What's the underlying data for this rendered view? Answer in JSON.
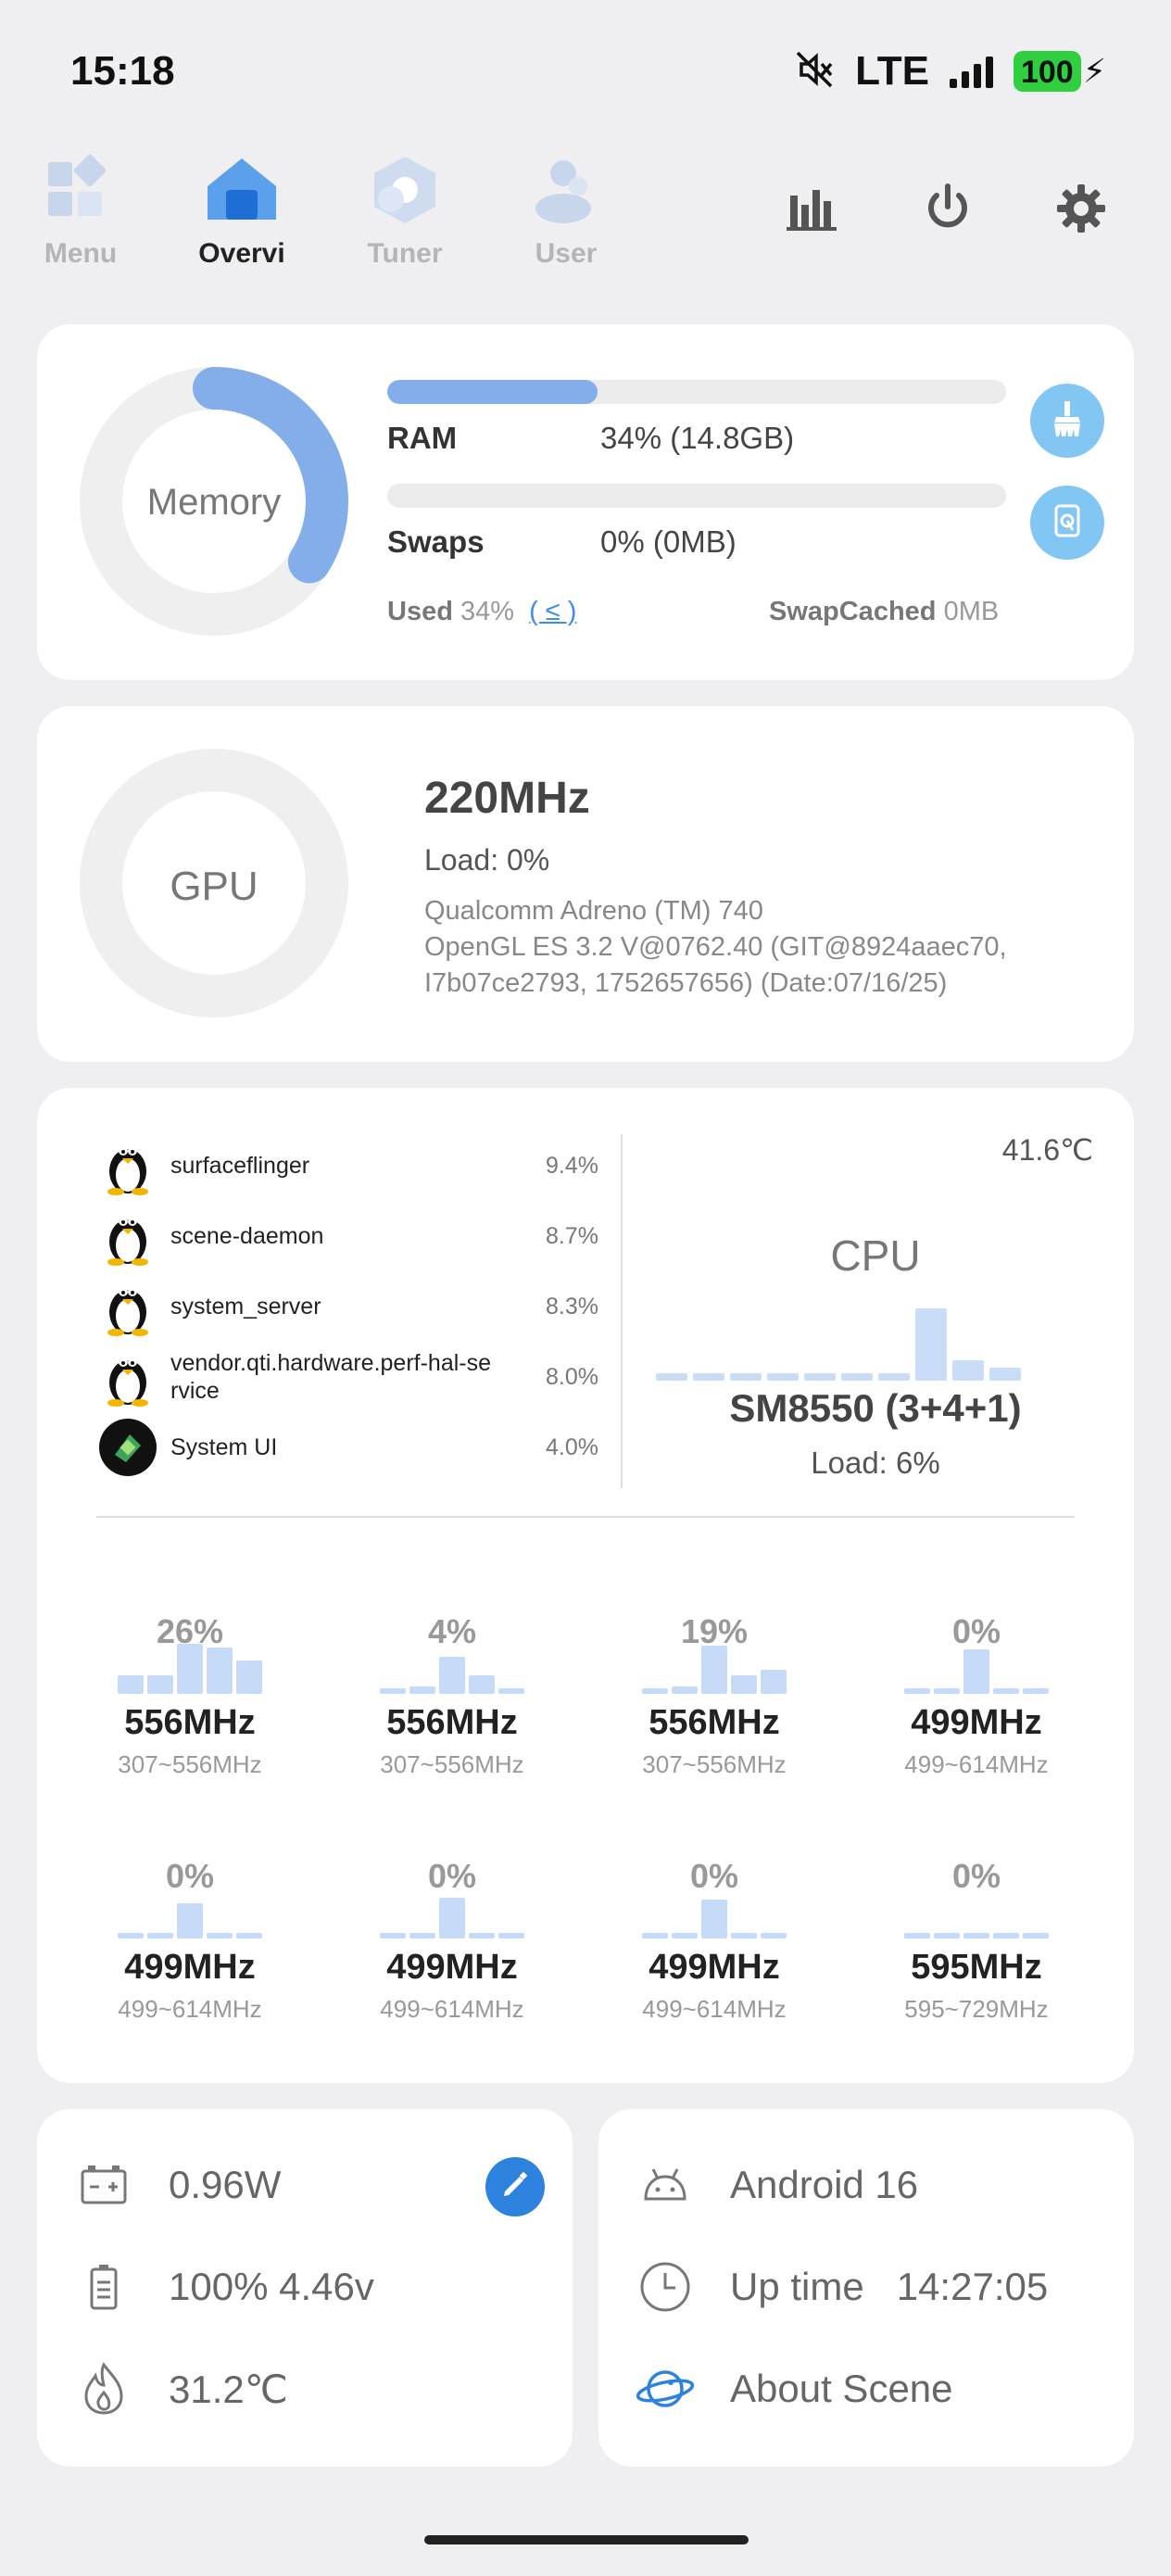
{
  "status_bar": {
    "time": "15:18",
    "network": "LTE",
    "battery": "100",
    "icons": [
      "mute-icon",
      "signal-icon",
      "charging-icon"
    ]
  },
  "nav": {
    "tabs": [
      {
        "label": "Menu",
        "active": false
      },
      {
        "label": "Overvi",
        "active": true
      },
      {
        "label": "Tuner",
        "active": false
      },
      {
        "label": "User",
        "active": false
      }
    ],
    "toolbar_icons": [
      "bar-chart-icon",
      "power-icon",
      "gear-icon"
    ]
  },
  "memory": {
    "donut_label": "Memory",
    "ram_label": "RAM",
    "ram_value": "34% (14.8GB)",
    "ram_fraction": 0.34,
    "swaps_label": "Swaps",
    "swaps_value": "0% (0MB)",
    "swaps_fraction": 0,
    "used_label": "Used",
    "used_value": "34%",
    "used_link": "( ≤ )",
    "swapcached_label": "SwapCached",
    "swapcached_value": "0MB"
  },
  "gpu": {
    "donut_label": "GPU",
    "frequency": "220MHz",
    "load": "Load: 0%",
    "renderer": "Qualcomm Adreno (TM) 740",
    "opengl": "OpenGL ES 3.2 V@0762.40 (GIT@8924aaec70, I7b07ce2793, 1752657656) (Date:07/16/25)"
  },
  "processes": [
    {
      "name": "surfaceflinger",
      "value": "9.4%",
      "icon": "linux-penguin-icon"
    },
    {
      "name": "scene-daemon",
      "value": "8.7%",
      "icon": "linux-penguin-icon"
    },
    {
      "name": "system_server",
      "value": "8.3%",
      "icon": "linux-penguin-icon"
    },
    {
      "name": "vendor.qti.hardware.perf-hal-se rvice",
      "value": "8.0%",
      "icon": "linux-penguin-icon"
    },
    {
      "name": "System UI",
      "value": "4.0%",
      "icon": "system-ui-icon"
    }
  ],
  "cpu": {
    "temperature": "41.6℃",
    "title": "CPU",
    "model": "SM8550 (3+4+1)",
    "load": "Load: 6%",
    "cores": [
      {
        "load": "26%",
        "freq": "556MHz",
        "range": "307~556MHz"
      },
      {
        "load": "4%",
        "freq": "556MHz",
        "range": "307~556MHz"
      },
      {
        "load": "19%",
        "freq": "556MHz",
        "range": "307~556MHz"
      },
      {
        "load": "0%",
        "freq": "499MHz",
        "range": "499~614MHz"
      },
      {
        "load": "0%",
        "freq": "499MHz",
        "range": "499~614MHz"
      },
      {
        "load": "0%",
        "freq": "499MHz",
        "range": "499~614MHz"
      },
      {
        "load": "0%",
        "freq": "499MHz",
        "range": "499~614MHz"
      },
      {
        "load": "0%",
        "freq": "595MHz",
        "range": "595~729MHz"
      }
    ]
  },
  "power_card": {
    "power": "0.96W",
    "battery": "100%  4.46v",
    "temperature": "31.2℃"
  },
  "system_card": {
    "android": "Android 16",
    "uptime": "Up time   14:27:05",
    "about": "About Scene"
  },
  "colors": {
    "accent": "#84aeea",
    "button_light_blue": "#82c6f3",
    "edit_blue": "#2d82de",
    "battery_green": "#2fcf3f"
  }
}
